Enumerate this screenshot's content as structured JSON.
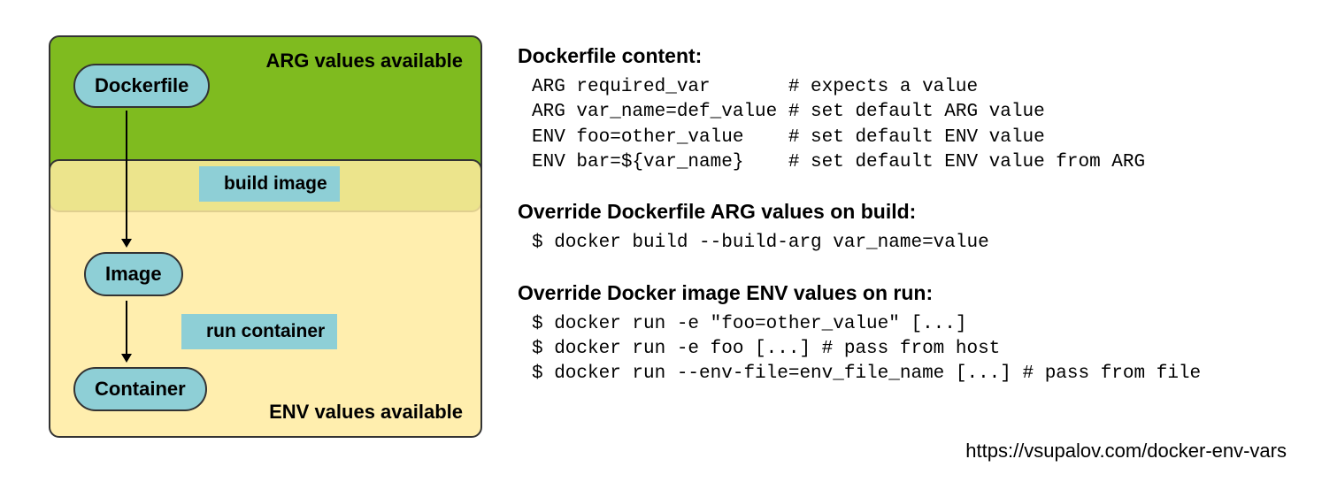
{
  "diagram": {
    "arg_label": "ARG values available",
    "env_label": "ENV values available",
    "dockerfile": "Dockerfile",
    "image": "Image",
    "container": "Container",
    "build_tag": "build image",
    "run_tag": "run container"
  },
  "sections": {
    "s1": {
      "title": "Dockerfile content:",
      "code": "ARG required_var       # expects a value\nARG var_name=def_value # set default ARG value\nENV foo=other_value    # set default ENV value\nENV bar=${var_name}    # set default ENV value from ARG"
    },
    "s2": {
      "title": "Override Dockerfile ARG values on build:",
      "code": "$ docker build --build-arg var_name=value"
    },
    "s3": {
      "title": "Override Docker image ENV values on run:",
      "code": "$ docker run -e \"foo=other_value\" [...]\n$ docker run -e foo [...] # pass from host\n$ docker run --env-file=env_file_name [...] # pass from file"
    }
  },
  "source": "https://vsupalov.com/docker-env-vars"
}
